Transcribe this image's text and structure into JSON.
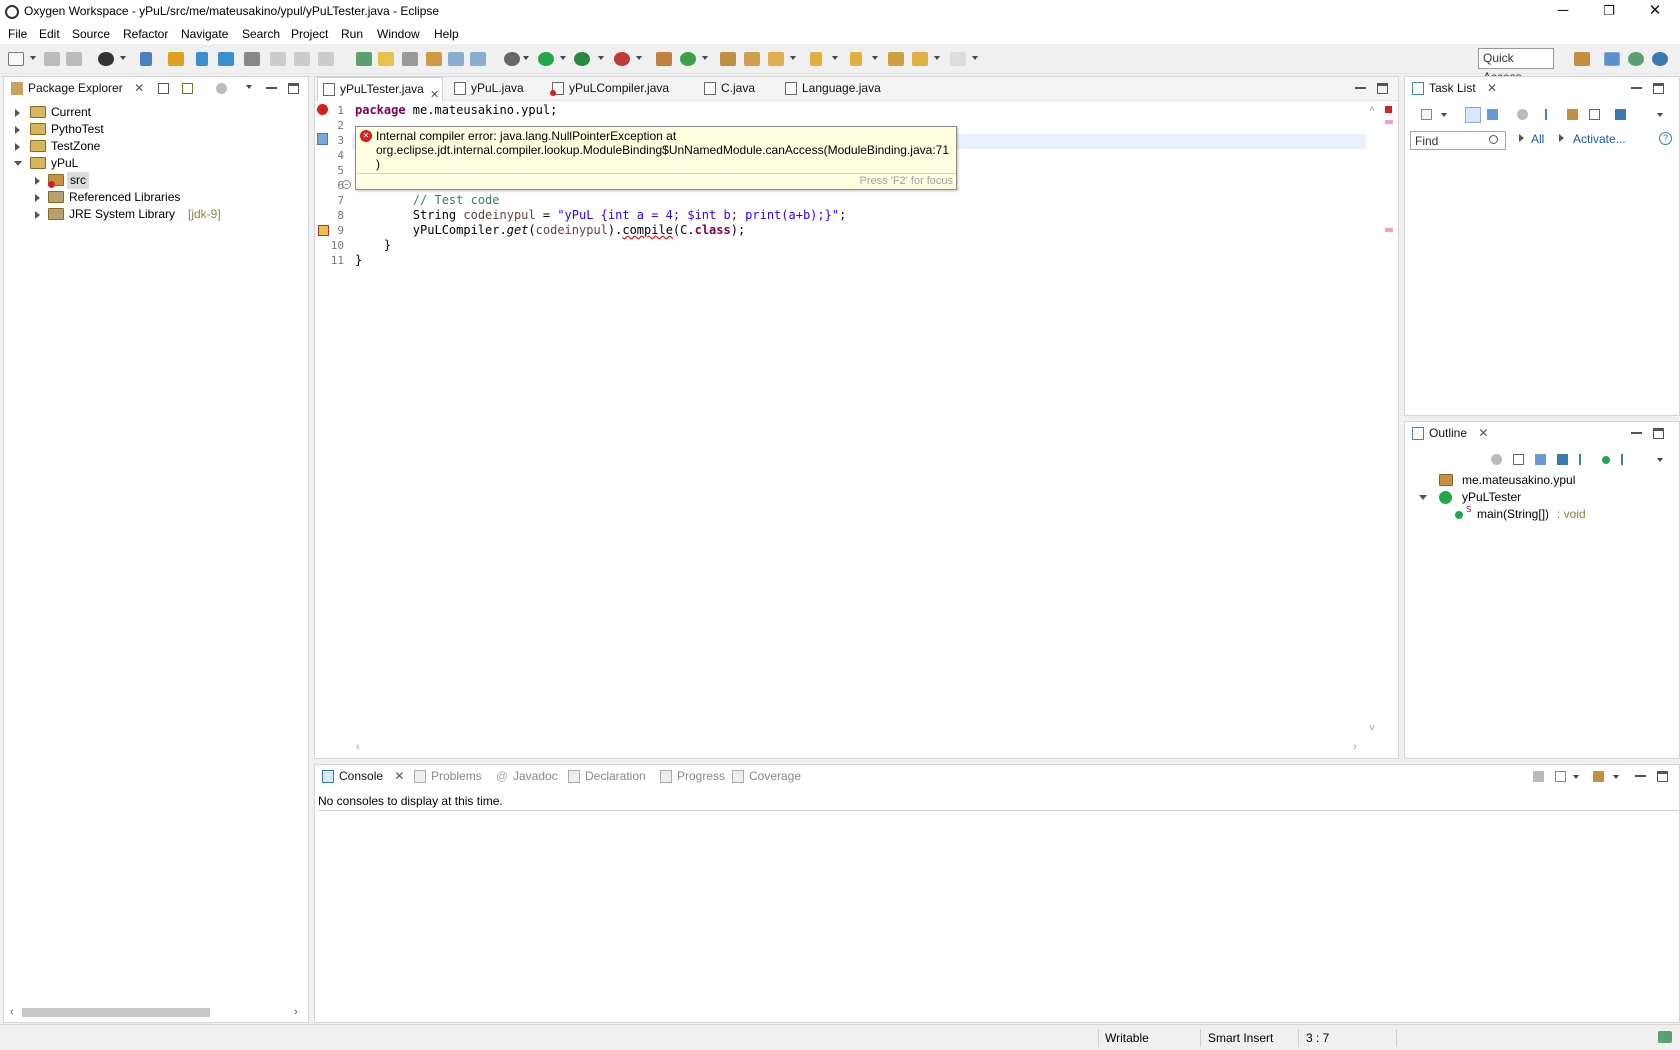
{
  "window": {
    "title": "Oxygen Workspace - yPuL/src/me/mateusakino/ypul/yPuLTester.java - Eclipse",
    "minimize": "─",
    "maximize": "❐",
    "close": "✕"
  },
  "menu": [
    "File",
    "Edit",
    "Source",
    "Refactor",
    "Navigate",
    "Search",
    "Project",
    "Run",
    "Window",
    "Help"
  ],
  "toolbar": {
    "quick_access": "Quick Access"
  },
  "package_explorer": {
    "title": "Package Explorer",
    "items": [
      {
        "label": "Current"
      },
      {
        "label": "PythoTest"
      },
      {
        "label": "TestZone"
      },
      {
        "label": "yPuL"
      },
      {
        "label": "src"
      },
      {
        "label": "Referenced Libraries"
      },
      {
        "label": "JRE System Library",
        "suffix": "[jdk-9]"
      }
    ]
  },
  "editor": {
    "tabs": [
      "yPuLTester.java",
      "yPuL.java",
      "yPuLCompiler.java",
      "C.java",
      "Language.java"
    ],
    "line_numbers": [
      "1",
      "2",
      "3",
      "4",
      "5",
      "6",
      "7",
      "8",
      "9",
      "10",
      "11"
    ],
    "lines": {
      "l1_kw": "package",
      "l1_rest": " me.mateusakino.ypul;",
      "l6": "",
      "l7": "        // Test code",
      "l8_type": "        String ",
      "l8_var": "codeinypul",
      "l8_eq": " = ",
      "l8_str": "\"yPuL {int a = 4; $int b; print(a+b);}\"",
      "l8_end": ";",
      "l9_a": "        yPuLCompiler.",
      "l9_get": "get",
      "l9_b": "(",
      "l9_var": "codeinypul",
      "l9_c": ").",
      "l9_compile": "compile",
      "l9_d": "(C.",
      "l9_kw": "class",
      "l9_e": ");",
      "l10": "    }",
      "l11": "}"
    },
    "hover": {
      "line1": "Internal compiler error: java.lang.NullPointerException at",
      "line2": "org.eclipse.jdt.internal.compiler.lookup.ModuleBinding$UnNamedModule.canAccess(ModuleBinding.java:71",
      "line3": ")",
      "hint": "Press 'F2' for focus"
    }
  },
  "task_list": {
    "title": "Task List",
    "find_placeholder": "Find",
    "all": "All",
    "activate": "Activate..."
  },
  "outline": {
    "title": "Outline",
    "package": "me.mateusakino.ypul",
    "class": "yPuLTester",
    "method": "main(String[])",
    "method_type": " : void",
    "static_mark": "S"
  },
  "bottom": {
    "tabs": [
      "Console",
      "Problems",
      "Javadoc",
      "Declaration",
      "Progress",
      "Coverage"
    ],
    "message": "No consoles to display at this time."
  },
  "status": {
    "writable": "Writable",
    "insert_mode": "Smart Insert",
    "position": "3 : 7"
  },
  "colors": {
    "keyword": "#7f0055",
    "comment": "#3f7f5f",
    "string": "#2a00ff",
    "variable": "#6a3e3e",
    "error": "#d42020",
    "tooltip_bg": "#ffffe1"
  }
}
